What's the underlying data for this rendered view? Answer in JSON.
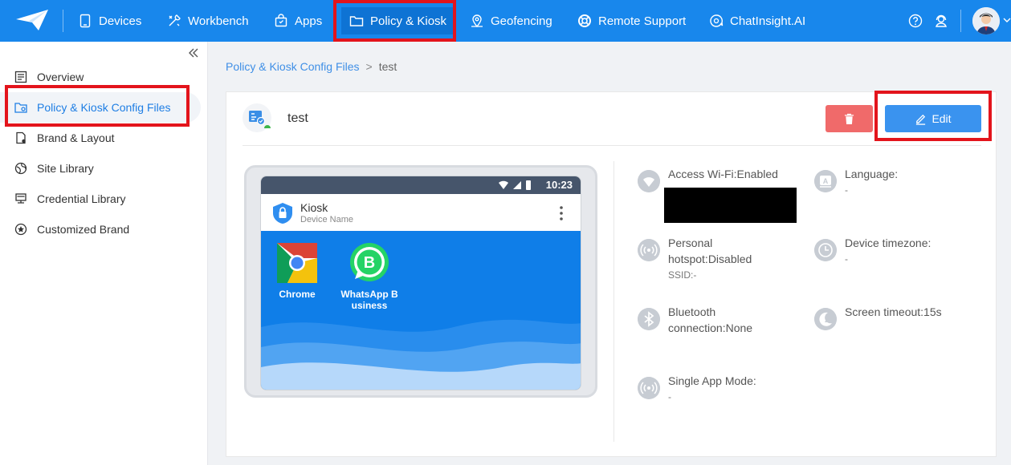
{
  "nav": {
    "items": [
      {
        "label": "Devices",
        "icon": "tablet-icon"
      },
      {
        "label": "Workbench",
        "icon": "tools-icon"
      },
      {
        "label": "Apps",
        "icon": "bag-icon"
      },
      {
        "label": "Policy & Kiosk",
        "icon": "folder-icon",
        "active": true
      },
      {
        "label": "Geofencing",
        "icon": "map-pin-icon"
      },
      {
        "label": "Remote Support",
        "icon": "lifebuoy-icon"
      },
      {
        "label": "ChatInsight.AI",
        "icon": "chat-ai-icon"
      }
    ]
  },
  "sidebar": {
    "items": [
      {
        "label": "Overview",
        "icon": "list-icon"
      },
      {
        "label": "Policy & Kiosk Config Files",
        "icon": "folder-settings-icon",
        "active": true
      },
      {
        "label": "Brand & Layout",
        "icon": "document-icon"
      },
      {
        "label": "Site Library",
        "icon": "globe-icon"
      },
      {
        "label": "Credential Library",
        "icon": "monitor-icon"
      },
      {
        "label": "Customized Brand",
        "icon": "star-icon"
      }
    ]
  },
  "breadcrumb": {
    "parent": "Policy & Kiosk Config Files",
    "separator": ">",
    "current": "test"
  },
  "detail": {
    "title": "test",
    "edit_label": "Edit"
  },
  "preview": {
    "status_time": "10:23",
    "kiosk_title": "Kiosk",
    "kiosk_subtitle": "Device Name",
    "apps": [
      {
        "name_line1": "Chrome",
        "name_line2": ""
      },
      {
        "name_line1": "WhatsApp B",
        "name_line2": "usiness"
      }
    ]
  },
  "settings": {
    "wifi": {
      "label": "Access Wi-Fi:Enabled"
    },
    "language": {
      "label": "Language:",
      "value": "-"
    },
    "hotspot": {
      "label_line1": "Personal",
      "label_line2": "hotspot:Disabled",
      "value": "SSID:-"
    },
    "timezone": {
      "label": "Device timezone:",
      "value": "-"
    },
    "bluetooth": {
      "label_line1": "Bluetooth",
      "label_line2": "connection:None"
    },
    "screen_timeout": {
      "label": "Screen timeout:15s"
    },
    "single_app": {
      "label": "Single App Mode:",
      "value": "-"
    }
  },
  "colors": {
    "nav_bg": "#1887ec",
    "nav_active": "#0e73d4",
    "highlight": "#e3141c",
    "edit_button": "#3a93ef",
    "delete_button": "#f06a6a",
    "launcher_bg": "#0f7ee8"
  }
}
